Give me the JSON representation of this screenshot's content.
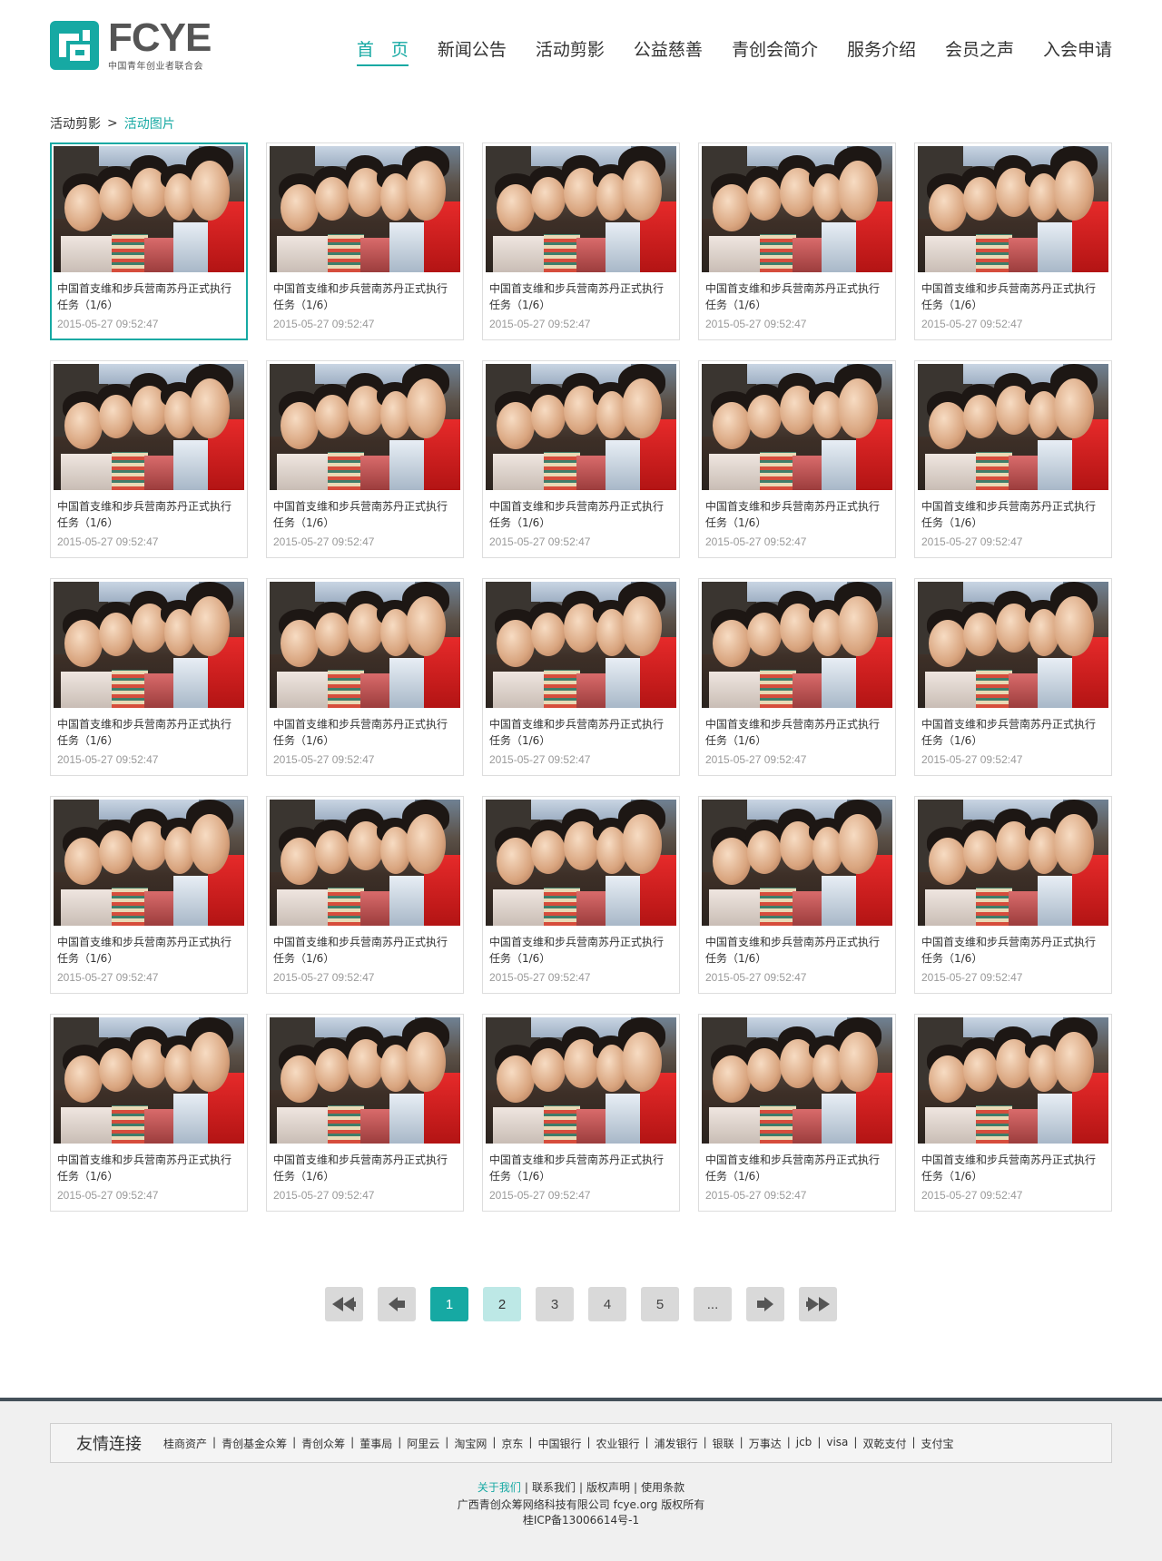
{
  "header": {
    "logo": {
      "word": "FCYE",
      "subtitle": "中国青年创业者联合会"
    },
    "nav": [
      {
        "label": "首　页",
        "active": true
      },
      {
        "label": "新闻公告"
      },
      {
        "label": "活动剪影"
      },
      {
        "label": "公益慈善"
      },
      {
        "label": "青创会简介"
      },
      {
        "label": "服务介绍"
      },
      {
        "label": "会员之声"
      },
      {
        "label": "入会申请"
      }
    ]
  },
  "breadcrumb": {
    "parent": "活动剪影",
    "separator": ">",
    "current": "活动图片"
  },
  "gallery": {
    "items": [
      {
        "title": "中国首支维和步兵营南苏丹正式执行任务（1/6）",
        "date": "2015-05-27 09:52:47",
        "selected": true
      },
      {
        "title": "中国首支维和步兵营南苏丹正式执行任务（1/6）",
        "date": "2015-05-27 09:52:47"
      },
      {
        "title": "中国首支维和步兵营南苏丹正式执行任务（1/6）",
        "date": "2015-05-27 09:52:47"
      },
      {
        "title": "中国首支维和步兵营南苏丹正式执行任务（1/6）",
        "date": "2015-05-27 09:52:47"
      },
      {
        "title": "中国首支维和步兵营南苏丹正式执行任务（1/6）",
        "date": "2015-05-27 09:52:47"
      },
      {
        "title": "中国首支维和步兵营南苏丹正式执行任务（1/6）",
        "date": "2015-05-27 09:52:47"
      },
      {
        "title": "中国首支维和步兵营南苏丹正式执行任务（1/6）",
        "date": "2015-05-27 09:52:47"
      },
      {
        "title": "中国首支维和步兵营南苏丹正式执行任务（1/6）",
        "date": "2015-05-27 09:52:47"
      },
      {
        "title": "中国首支维和步兵营南苏丹正式执行任务（1/6）",
        "date": "2015-05-27 09:52:47"
      },
      {
        "title": "中国首支维和步兵营南苏丹正式执行任务（1/6）",
        "date": "2015-05-27 09:52:47"
      },
      {
        "title": "中国首支维和步兵营南苏丹正式执行任务（1/6）",
        "date": "2015-05-27 09:52:47"
      },
      {
        "title": "中国首支维和步兵营南苏丹正式执行任务（1/6）",
        "date": "2015-05-27 09:52:47"
      },
      {
        "title": "中国首支维和步兵营南苏丹正式执行任务（1/6）",
        "date": "2015-05-27 09:52:47"
      },
      {
        "title": "中国首支维和步兵营南苏丹正式执行任务（1/6）",
        "date": "2015-05-27 09:52:47"
      },
      {
        "title": "中国首支维和步兵营南苏丹正式执行任务（1/6）",
        "date": "2015-05-27 09:52:47"
      },
      {
        "title": "中国首支维和步兵营南苏丹正式执行任务（1/6）",
        "date": "2015-05-27 09:52:47"
      },
      {
        "title": "中国首支维和步兵营南苏丹正式执行任务（1/6）",
        "date": "2015-05-27 09:52:47"
      },
      {
        "title": "中国首支维和步兵营南苏丹正式执行任务（1/6）",
        "date": "2015-05-27 09:52:47"
      },
      {
        "title": "中国首支维和步兵营南苏丹正式执行任务（1/6）",
        "date": "2015-05-27 09:52:47"
      },
      {
        "title": "中国首支维和步兵营南苏丹正式执行任务（1/6）",
        "date": "2015-05-27 09:52:47"
      },
      {
        "title": "中国首支维和步兵营南苏丹正式执行任务（1/6）",
        "date": "2015-05-27 09:52:47"
      },
      {
        "title": "中国首支维和步兵营南苏丹正式执行任务（1/6）",
        "date": "2015-05-27 09:52:47"
      },
      {
        "title": "中国首支维和步兵营南苏丹正式执行任务（1/6）",
        "date": "2015-05-27 09:52:47"
      },
      {
        "title": "中国首支维和步兵营南苏丹正式执行任务（1/6）",
        "date": "2015-05-27 09:52:47"
      },
      {
        "title": "中国首支维和步兵营南苏丹正式执行任务（1/6）",
        "date": "2015-05-27 09:52:47"
      }
    ]
  },
  "pagination": {
    "first_icon": "double-left-arrow-icon",
    "prev_icon": "left-arrow-icon",
    "pages": [
      "1",
      "2",
      "3",
      "4",
      "5"
    ],
    "current_page": "1",
    "ellipsis": "...",
    "next_icon": "right-arrow-icon",
    "last_icon": "double-right-arrow-icon"
  },
  "footer": {
    "links_title": "友情连接",
    "links": [
      "桂商资产",
      "青创基金众筹",
      "青创众筹",
      "董事局",
      "阿里云",
      "淘宝网",
      "京东",
      "中国银行",
      "农业银行",
      "浦发银行",
      "银联",
      "万事达",
      "jcb",
      "visa",
      "双乾支付",
      "支付宝"
    ],
    "nav": [
      "关于我们",
      "联系我们",
      "版权声明",
      "使用条款"
    ],
    "company": "广西青创众筹网络科技有限公司 fcye.org 版权所有",
    "icp": "桂ICP备13006614号-1"
  },
  "colors": {
    "accent": "#16a9a3",
    "footer_bar": "#45515a",
    "pager_idle": "#d9d9d9",
    "pager_hover": "#bde8e6"
  }
}
